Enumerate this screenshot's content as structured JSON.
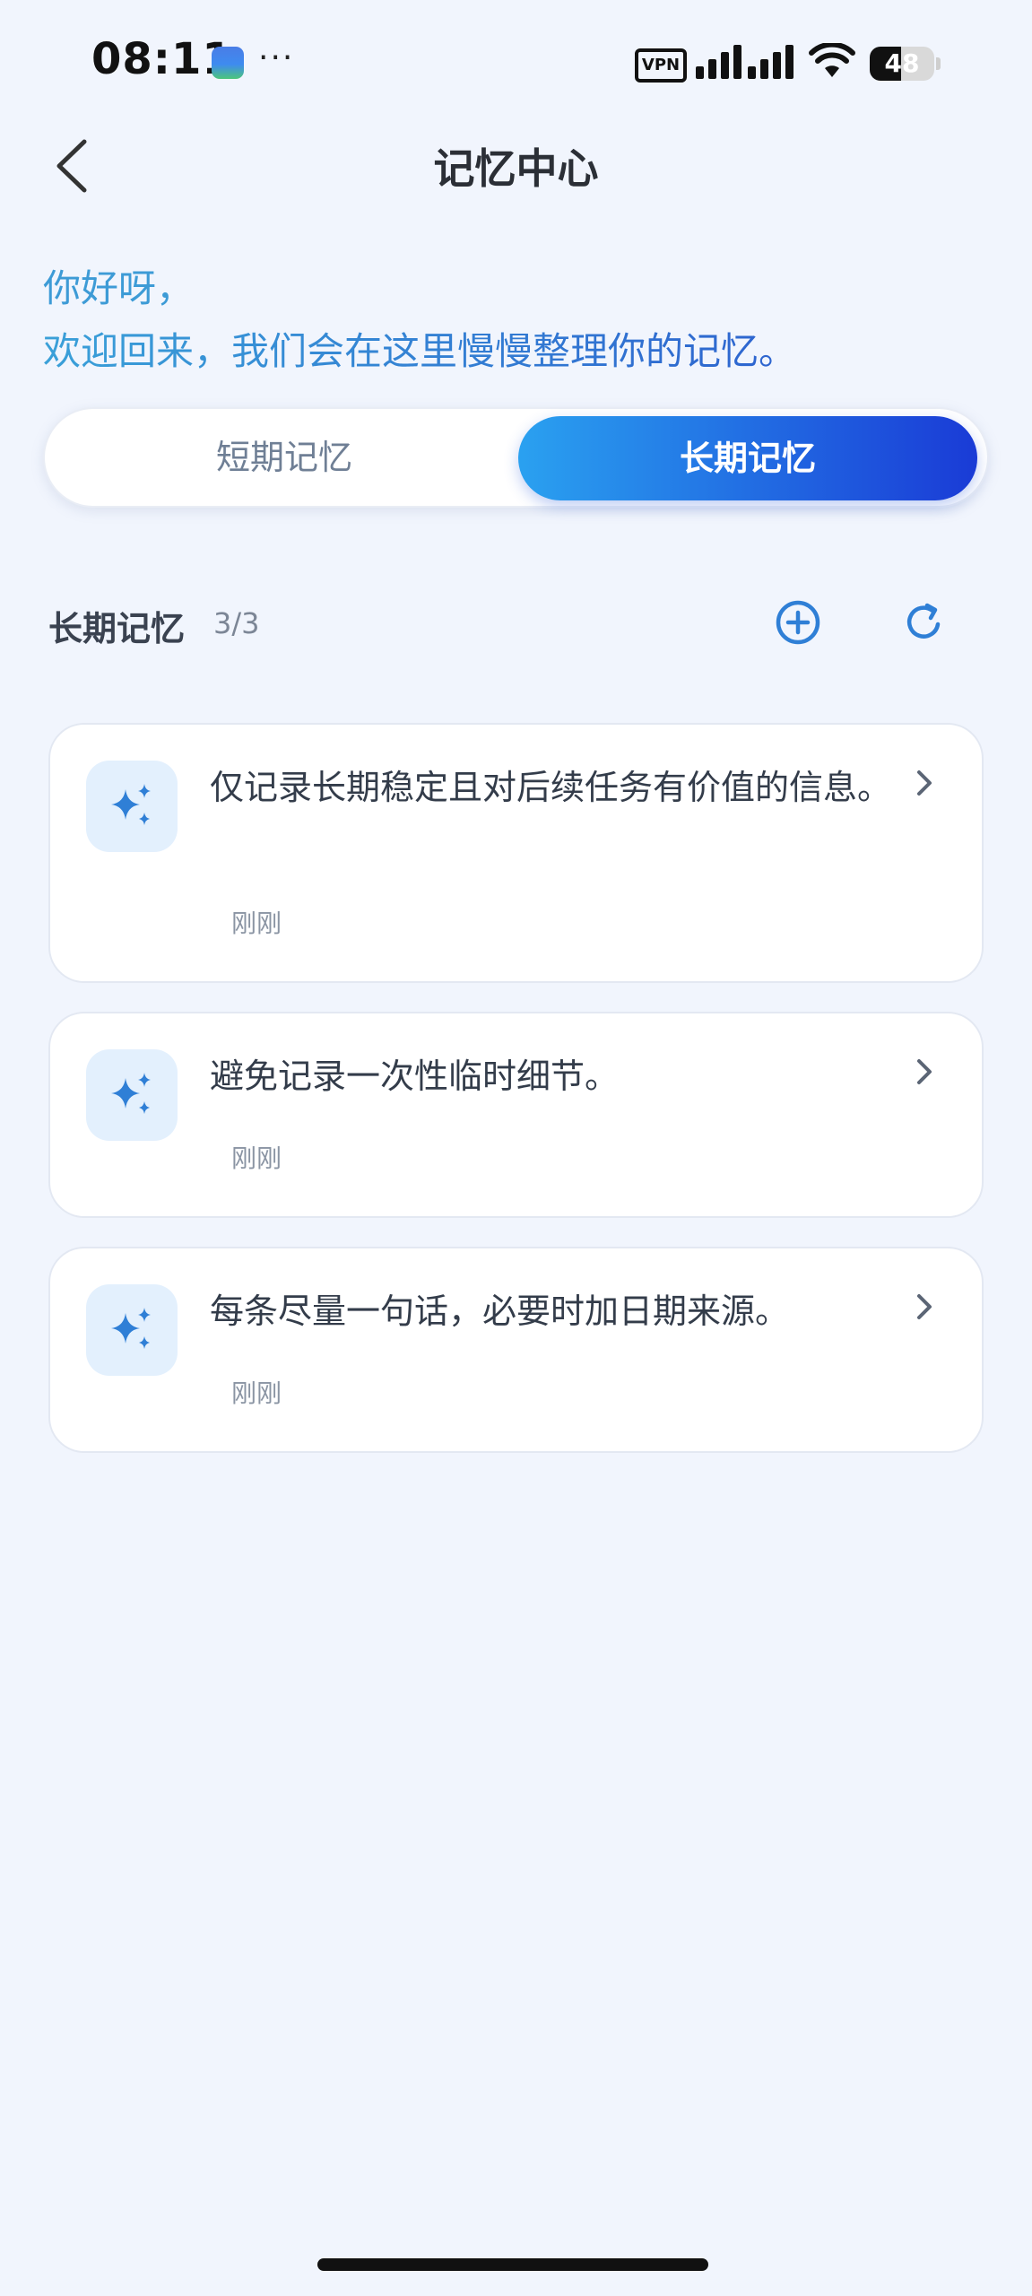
{
  "status": {
    "time": "08:11",
    "dots": "···",
    "vpn": "VPN",
    "battery": "48"
  },
  "header": {
    "title": "记忆中心"
  },
  "greeting": {
    "line1": "你好呀，",
    "line2": "欢迎回来，我们会在这里慢慢整理你的记忆。"
  },
  "tabs": {
    "short": "短期记忆",
    "long": "长期记忆",
    "active": "long"
  },
  "section": {
    "title": "长期记忆",
    "count": "3/3"
  },
  "memories": [
    {
      "text": "仅记录长期稳定且对后续任务有价值的信息。",
      "time": "刚刚"
    },
    {
      "text": "避免记录一次性临时细节。",
      "time": "刚刚"
    },
    {
      "text": "每条尽量一句话，必要时加日期来源。",
      "time": "刚刚"
    }
  ],
  "colors": {
    "accent_start": "#2aa1f0",
    "accent_end": "#1a3bd6",
    "icon_blue": "#2f7fd6",
    "background": "#f1f5fd"
  },
  "icons": [
    "back-chevron-icon",
    "add-circle-icon",
    "refresh-icon",
    "sparkle-icon",
    "chevron-right-icon"
  ]
}
